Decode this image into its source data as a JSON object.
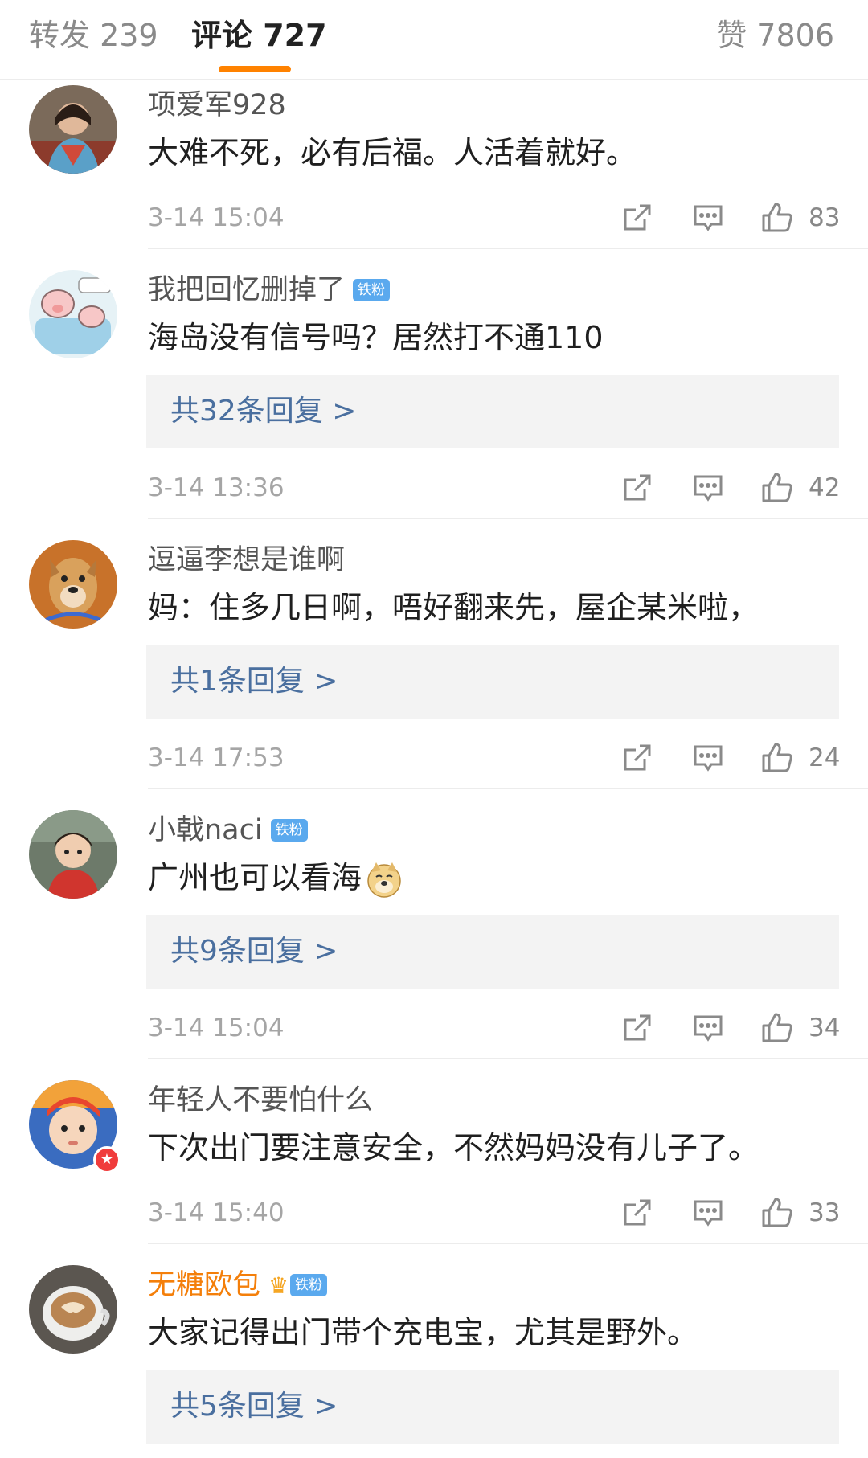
{
  "tabs": {
    "forward": "转发 239",
    "comments": "评论 727",
    "likes": "赞 7806"
  },
  "colors": {
    "accent": "#ff8200",
    "link": "#4a6f9f",
    "fan_badge": "#5aa9ee",
    "vip_name": "#f47f0a"
  },
  "comments": [
    {
      "username": "项爱军928",
      "text": "大难不死，必有后福。人活着就好。",
      "time": "3-14 15:04",
      "likes": "83"
    },
    {
      "username": "我把回忆删掉了",
      "badge": "铁粉",
      "text": "海岛没有信号吗？居然打不通110",
      "replies": "共32条回复 >",
      "time": "3-14 13:36",
      "likes": "42"
    },
    {
      "username": "逗逼李想是谁啊",
      "text": "妈：住多几日啊，唔好翻来先，屋企某米啦，",
      "replies": "共1条回复 >",
      "time": "3-14 17:53",
      "likes": "24"
    },
    {
      "username": "小戟naci",
      "badge": "铁粉",
      "text": "广州也可以看海",
      "emoji": "doge-emoji",
      "replies": "共9条回复 >",
      "time": "3-14 15:04",
      "likes": "34"
    },
    {
      "username": "年轻人不要怕什么",
      "text": "下次出门要注意安全，不然妈妈没有儿子了。",
      "time": "3-14 15:40",
      "likes": "33"
    },
    {
      "username": "无糖欧包",
      "badge": "铁粉",
      "crown": "crown-icon",
      "text": "大家记得出门带个充电宝，尤其是野外。",
      "replies": "共5条回复 >"
    }
  ]
}
